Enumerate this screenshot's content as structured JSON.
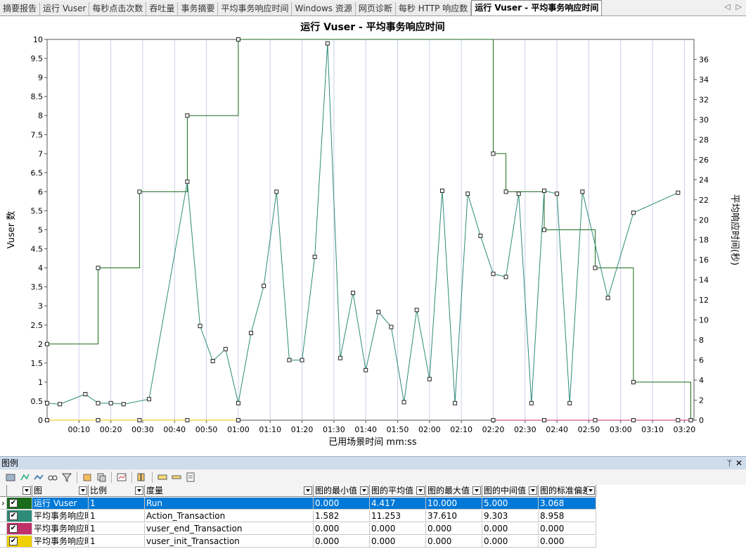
{
  "tabs": [
    {
      "label": "摘要报告"
    },
    {
      "label": "运行 Vuser"
    },
    {
      "label": "每秒点击次数"
    },
    {
      "label": "吞吐量"
    },
    {
      "label": "事务摘要"
    },
    {
      "label": "平均事务响应时间"
    },
    {
      "label": "Windows 资源"
    },
    {
      "label": "网页诊断"
    },
    {
      "label": "每秒 HTTP 响应数"
    },
    {
      "label": "运行 Vuser - 平均事务响应时间",
      "active": true
    }
  ],
  "chart_data": {
    "type": "line",
    "title": "运行 Vuser - 平均事务响应时间",
    "xlabel": "已用场景时间 mm:ss",
    "ylabel": "Vuser 数",
    "y2label": "平均响应时间(秒)",
    "ylim": [
      0,
      10
    ],
    "y2lim": [
      0,
      38
    ],
    "xlim_seconds": [
      0,
      203
    ],
    "x_ticks": [
      "00:10",
      "00:20",
      "00:30",
      "00:40",
      "00:50",
      "01:00",
      "01:10",
      "01:20",
      "01:30",
      "01:40",
      "01:50",
      "02:00",
      "02:10",
      "02:20",
      "02:30",
      "02:40",
      "02:50",
      "03:00",
      "03:10",
      "03:20"
    ],
    "y_ticks": [
      "0",
      "0.5",
      "1",
      "1.5",
      "2",
      "2.5",
      "3",
      "3.5",
      "4",
      "4.5",
      "5",
      "5.5",
      "6",
      "6.5",
      "7",
      "7.5",
      "8",
      "8.5",
      "9",
      "9.5",
      "10"
    ],
    "y2_ticks": [
      "0",
      "2",
      "4",
      "6",
      "8",
      "10",
      "12",
      "14",
      "16",
      "18",
      "20",
      "22",
      "24",
      "26",
      "28",
      "30",
      "32",
      "34",
      "36"
    ],
    "grid": true,
    "series": [
      {
        "name": "运行 Vuser",
        "axis": "left",
        "step": true,
        "color": "#1a6b1a",
        "x": [
          "00:00",
          "00:16",
          "00:29",
          "00:44",
          "01:00",
          "02:20",
          "02:24",
          "02:36",
          "02:52",
          "03:04",
          "03:22"
        ],
        "values": [
          2,
          4,
          6,
          8,
          10,
          7,
          6,
          5,
          4,
          1,
          0
        ]
      },
      {
        "name": "Action_Transaction",
        "axis": "right",
        "step": false,
        "color": "#2e8b77",
        "x": [
          "00:00",
          "00:04",
          "00:12",
          "00:16",
          "00:20",
          "00:24",
          "00:32",
          "00:44",
          "00:48",
          "00:52",
          "00:56",
          "01:00",
          "01:04",
          "01:08",
          "01:12",
          "01:16",
          "01:20",
          "01:24",
          "01:28",
          "01:32",
          "01:36",
          "01:40",
          "01:44",
          "01:48",
          "01:52",
          "01:56",
          "02:00",
          "02:04",
          "02:08",
          "02:12",
          "02:16",
          "02:20",
          "02:24",
          "02:28",
          "02:32",
          "02:36",
          "02:40",
          "02:44",
          "02:48",
          "02:56",
          "03:04",
          "03:18"
        ],
        "values": [
          1.7,
          1.6,
          2.6,
          1.7,
          1.7,
          1.6,
          2.1,
          23.8,
          9.4,
          5.9,
          7.1,
          1.7,
          8.7,
          13.4,
          22.8,
          6.0,
          6.0,
          16.3,
          37.6,
          6.2,
          12.7,
          5.0,
          10.8,
          9.3,
          1.8,
          11.0,
          4.1,
          22.9,
          1.7,
          22.6,
          18.4,
          14.6,
          14.3,
          22.6,
          1.7,
          22.9,
          22.6,
          1.7,
          22.8,
          12.2,
          20.7,
          22.7
        ]
      },
      {
        "name": "vuser_end_Transaction",
        "axis": "right",
        "step": false,
        "color": "#c0306a",
        "x": [
          "02:20",
          "02:36",
          "02:52",
          "03:04",
          "03:18",
          "03:22"
        ],
        "values": [
          0,
          0,
          0,
          0,
          0,
          0
        ]
      },
      {
        "name": "vuser_init_Transaction",
        "axis": "right",
        "step": false,
        "color": "#e8c600",
        "x": [
          "00:00",
          "00:16",
          "00:29",
          "00:44",
          "01:00"
        ],
        "values": [
          0,
          0,
          0,
          0,
          0
        ]
      }
    ]
  },
  "legend": {
    "title": "图例",
    "pin": "ᛘ",
    "close": "✕",
    "columns": [
      "图",
      "比例",
      "度量",
      "图的最小值",
      "图的平均值",
      "图的最大值",
      "图的中间值",
      "图的标准偏差"
    ],
    "rows": [
      {
        "color": "#1a6b1a",
        "checked": true,
        "graph": "运行 Vuser",
        "scale": "1",
        "measure": "Run",
        "min": "0.000",
        "avg": "4.417",
        "max": "10.000",
        "median": "5.000",
        "std": "3.068",
        "selected": true
      },
      {
        "color": "#2e8b77",
        "checked": true,
        "graph": "平均事务响应时",
        "scale": "1",
        "measure": "Action_Transaction",
        "min": "1.582",
        "avg": "11.253",
        "max": "37.610",
        "median": "9.303",
        "std": "8.958"
      },
      {
        "color": "#c0306a",
        "checked": true,
        "graph": "平均事务响应时",
        "scale": "1",
        "measure": "vuser_end_Transaction",
        "min": "0.000",
        "avg": "0.000",
        "max": "0.000",
        "median": "0.000",
        "std": "0.000"
      },
      {
        "color": "#f0d000",
        "checked": true,
        "graph": "平均事务响应时",
        "scale": "1",
        "measure": "vuser_init_Transaction",
        "min": "0.000",
        "avg": "0.000",
        "max": "0.000",
        "median": "0.000",
        "std": "0.000"
      }
    ]
  },
  "check_mark": "✔"
}
